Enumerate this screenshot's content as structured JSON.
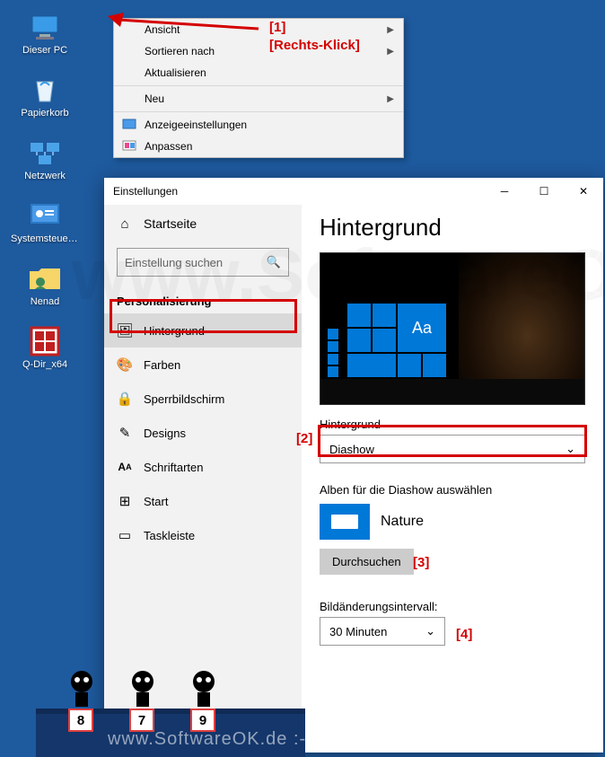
{
  "desktop": {
    "icons": [
      "Dieser PC",
      "Papierkorb",
      "Netzwerk",
      "Systemsteuerung",
      "Nenad",
      "Q-Dir_x64"
    ]
  },
  "ctxmenu": {
    "view": "Ansicht",
    "sort": "Sortieren nach",
    "refresh": "Aktualisieren",
    "new": "Neu",
    "display": "Anzeigeeinstellungen",
    "personalize": "Anpassen"
  },
  "annotations": {
    "a1": "[1]",
    "rightclick": "[Rechts-Klick]",
    "a2": "[2]",
    "a3": "[3]",
    "a4": "[4]"
  },
  "settings": {
    "windowTitle": "Einstellungen",
    "home": "Startseite",
    "searchPlaceholder": "Einstellung suchen",
    "category": "Personalisierung",
    "nav": {
      "background": "Hintergrund",
      "colors": "Farben",
      "lockscreen": "Sperrbildschirm",
      "themes": "Designs",
      "fonts": "Schriftarten",
      "start": "Start",
      "taskbar": "Taskleiste"
    },
    "main": {
      "heading": "Hintergrund",
      "previewAa": "Aa",
      "bgLabel": "Hintergrund",
      "bgValue": "Diashow",
      "albumLabel": "Alben für die Diashow auswählen",
      "albumName": "Nature",
      "browse": "Durchsuchen",
      "intervalLabel": "Bildänderungsintervall:",
      "intervalValue": "30 Minuten"
    }
  },
  "mascots": [
    "8",
    "7",
    "9"
  ],
  "watermark": "www.SoftwareOK.de  :-)"
}
